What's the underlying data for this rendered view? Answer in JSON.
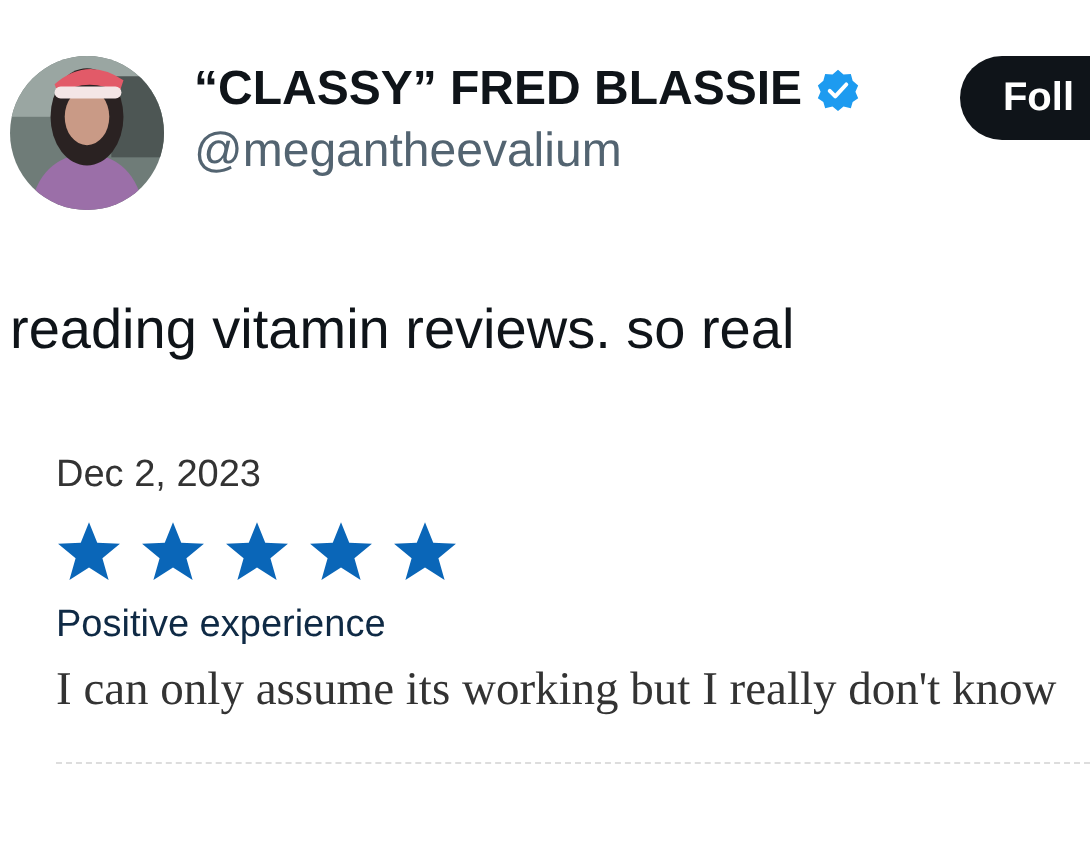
{
  "author": {
    "display_name": "“CLASSY” FRED BLASSIE",
    "verified": true,
    "handle": "@megantheevalium"
  },
  "follow_button": {
    "label": "Foll"
  },
  "tweet_text": "reading vitamin reviews. so real",
  "review": {
    "date": "Dec 2, 2023",
    "stars": 5,
    "title": "Positive experience",
    "body": "I can only assume its working but I really don't know"
  }
}
